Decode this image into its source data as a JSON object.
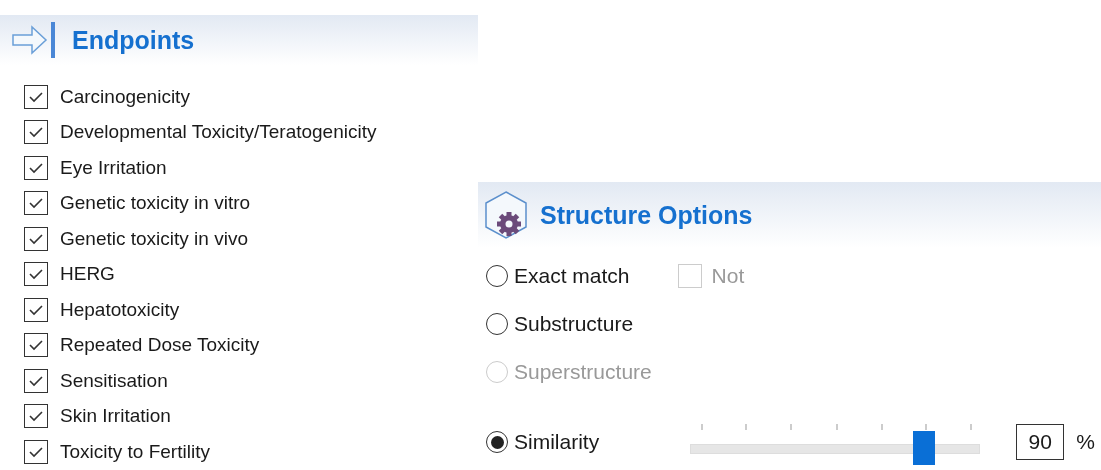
{
  "endpoints": {
    "title": "Endpoints",
    "items": [
      {
        "label": "Carcinogenicity",
        "checked": true
      },
      {
        "label": "Developmental Toxicity/Teratogenicity",
        "checked": true
      },
      {
        "label": "Eye Irritation",
        "checked": true
      },
      {
        "label": "Genetic toxicity in vitro",
        "checked": true
      },
      {
        "label": "Genetic toxicity in vivo",
        "checked": true
      },
      {
        "label": "HERG",
        "checked": true
      },
      {
        "label": "Hepatotoxicity",
        "checked": true
      },
      {
        "label": "Repeated Dose Toxicity",
        "checked": true
      },
      {
        "label": "Sensitisation",
        "checked": true
      },
      {
        "label": "Skin Irritation",
        "checked": true
      },
      {
        "label": "Toxicity to Fertility",
        "checked": true
      }
    ]
  },
  "structure_options": {
    "title": "Structure Options",
    "not_checkbox": {
      "label": "Not",
      "checked": false,
      "disabled": true
    },
    "options": [
      {
        "label": "Exact match",
        "selected": false,
        "disabled": false
      },
      {
        "label": "Substructure",
        "selected": false,
        "disabled": false
      },
      {
        "label": "Superstructure",
        "selected": false,
        "disabled": true
      },
      {
        "label": "Similarity",
        "selected": true,
        "disabled": false
      }
    ],
    "similarity": {
      "level": 0.81,
      "value": "90",
      "unit": "%"
    }
  }
}
